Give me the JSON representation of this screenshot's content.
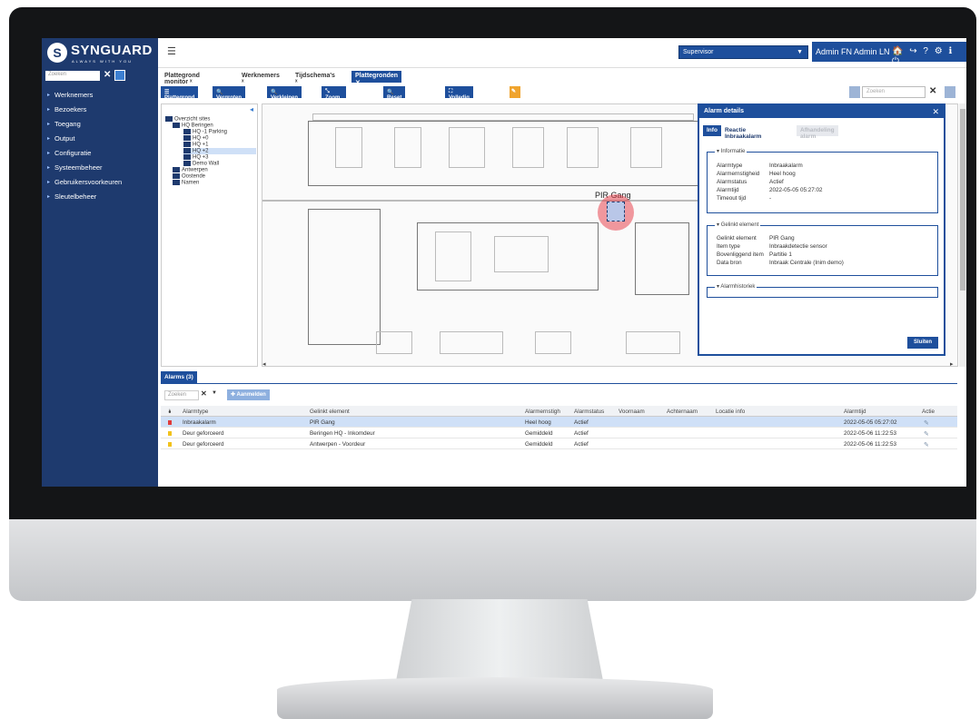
{
  "header": {
    "logo_name": "SYNGUARD",
    "logo_tagline": "ALWAYS WITH YOU",
    "menu_icon": "menu-icon",
    "role_select": "Supervisor",
    "user_name": "Admin FN Admin LN",
    "user_icons": "🏠 ↪ ? ⚙ ℹ ⏻"
  },
  "sidebar": {
    "search_placeholder": "Zoeken",
    "items": [
      "Werknemers",
      "Bezoekers",
      "Toegang",
      "Output",
      "Configuratie",
      "Systeembeheer",
      "Gebruikersvoorkeuren",
      "Sleutelbeheer"
    ]
  },
  "tabs": [
    "Plattegrond monitor",
    "Werknemers",
    "Tijdschema's",
    "Plattegronden"
  ],
  "toolbar": [
    "☰ Plattegrond",
    "🔍 Vergroten",
    "🔍 Verkleinen",
    "⤡ Zoom pagina",
    "🔍 Reset zoom",
    "⛶ Volledig scherm"
  ],
  "right_search_placeholder": "Zoeken",
  "tree": [
    {
      "label": "Overzicht sites",
      "indent": 0
    },
    {
      "label": "HQ Beringen",
      "indent": 1
    },
    {
      "label": "HQ -1 Parking",
      "indent": 2
    },
    {
      "label": "HQ +0",
      "indent": 2
    },
    {
      "label": "HQ +1",
      "indent": 2
    },
    {
      "label": "HQ +2",
      "indent": 2,
      "selected": true
    },
    {
      "label": "HQ +3",
      "indent": 2
    },
    {
      "label": "Demo Wall",
      "indent": 2
    },
    {
      "label": "Antwerpen",
      "indent": 1
    },
    {
      "label": "Oostende",
      "indent": 1
    },
    {
      "label": "Namen",
      "indent": 1
    }
  ],
  "sensor_label": "PIR Gang",
  "dialog": {
    "title": "Alarm details",
    "tabs": [
      "Info",
      "Reactie Inbraakalarm",
      "Afhandeling alarm"
    ],
    "info_legend": "Informatie",
    "info": [
      {
        "k": "Alarmtype",
        "v": "Inbraakalarm"
      },
      {
        "k": "Alarmernstigheid",
        "v": "Heel hoog"
      },
      {
        "k": "Alarmstatus",
        "v": "Actief"
      },
      {
        "k": "Alarmtijd",
        "v": "2022-05-05 05:27:02"
      },
      {
        "k": "Timeout tijd",
        "v": "-"
      }
    ],
    "linked_legend": "Gelinkt element",
    "linked": [
      {
        "k": "Gelinkt element",
        "v": "PIR Gang"
      },
      {
        "k": "Item type",
        "v": "Inbraakdetectie sensor"
      },
      {
        "k": "Bovenliggend item",
        "v": "Partitie 1"
      },
      {
        "k": "Data bron",
        "v": "Inbraak Centrale (Inim demo)"
      }
    ],
    "history_legend": "Alarmhistoriek",
    "close_button": "Sluiten"
  },
  "alarms": {
    "title": "Alarms (3)",
    "search_placeholder": "Zoeken",
    "add_button": "Aanmelden",
    "columns": [
      "Alarmtype",
      "Gelinkt element",
      "Alarmernstigh",
      "Alarmstatus",
      "Voornaam",
      "Achternaam",
      "Locatie info",
      "Alarmtijd",
      "Actie"
    ],
    "rows": [
      {
        "type": "Inbraakalarm",
        "element": "PIR Gang",
        "severity": "Heel hoog",
        "status": "Actief",
        "first": "",
        "last": "",
        "location": "",
        "time": "2022-05-05 05:27:02",
        "color": "#e03a3a"
      },
      {
        "type": "Deur geforceerd",
        "element": "Beringen HQ - Inkomdeur",
        "severity": "Gemiddeld",
        "status": "Actief",
        "first": "",
        "last": "",
        "location": "",
        "time": "2022-05-06 11:22:53",
        "color": "#f2c21b"
      },
      {
        "type": "Deur geforceerd",
        "element": "Antwerpen - Voordeur",
        "severity": "Gemiddeld",
        "status": "Actief",
        "first": "",
        "last": "",
        "location": "",
        "time": "2022-05-06 11:22:53",
        "color": "#f2c21b"
      }
    ]
  }
}
